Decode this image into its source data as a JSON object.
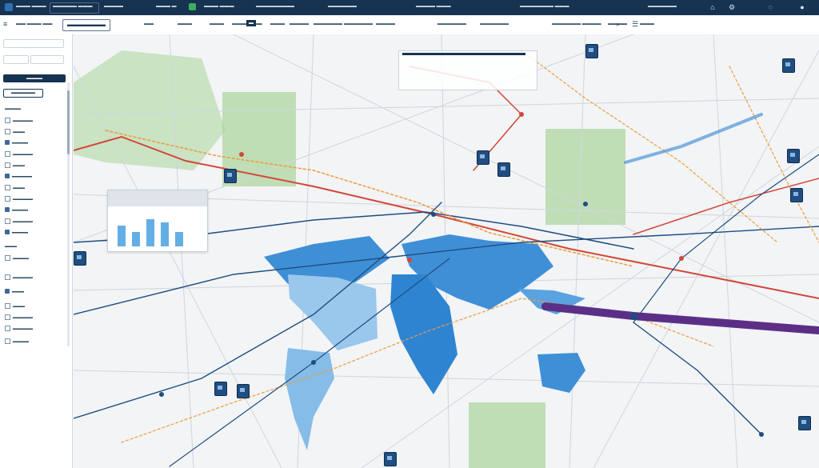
{
  "topbar": {
    "title": "",
    "icons": [
      "home-icon",
      "settings-icon",
      "help-icon",
      "user-icon"
    ]
  },
  "toolbar": {
    "brand": "",
    "icons": [
      "menu-icon",
      "search-icon",
      "layers-icon",
      "share-icon"
    ]
  },
  "sidebar": {
    "icons": [
      "filter-icon",
      "layer-icon",
      "route-icon"
    ]
  },
  "map": {
    "colors": {
      "water": "#3f8fd6",
      "land_light": "#9ac7ec",
      "park": "#b9dcae",
      "route_red": "#d2473a",
      "route_orange": "#ef9a3a",
      "route_navy": "#1e4d80",
      "route_purple": "#5b2f86",
      "road": "#cfd6de"
    }
  }
}
